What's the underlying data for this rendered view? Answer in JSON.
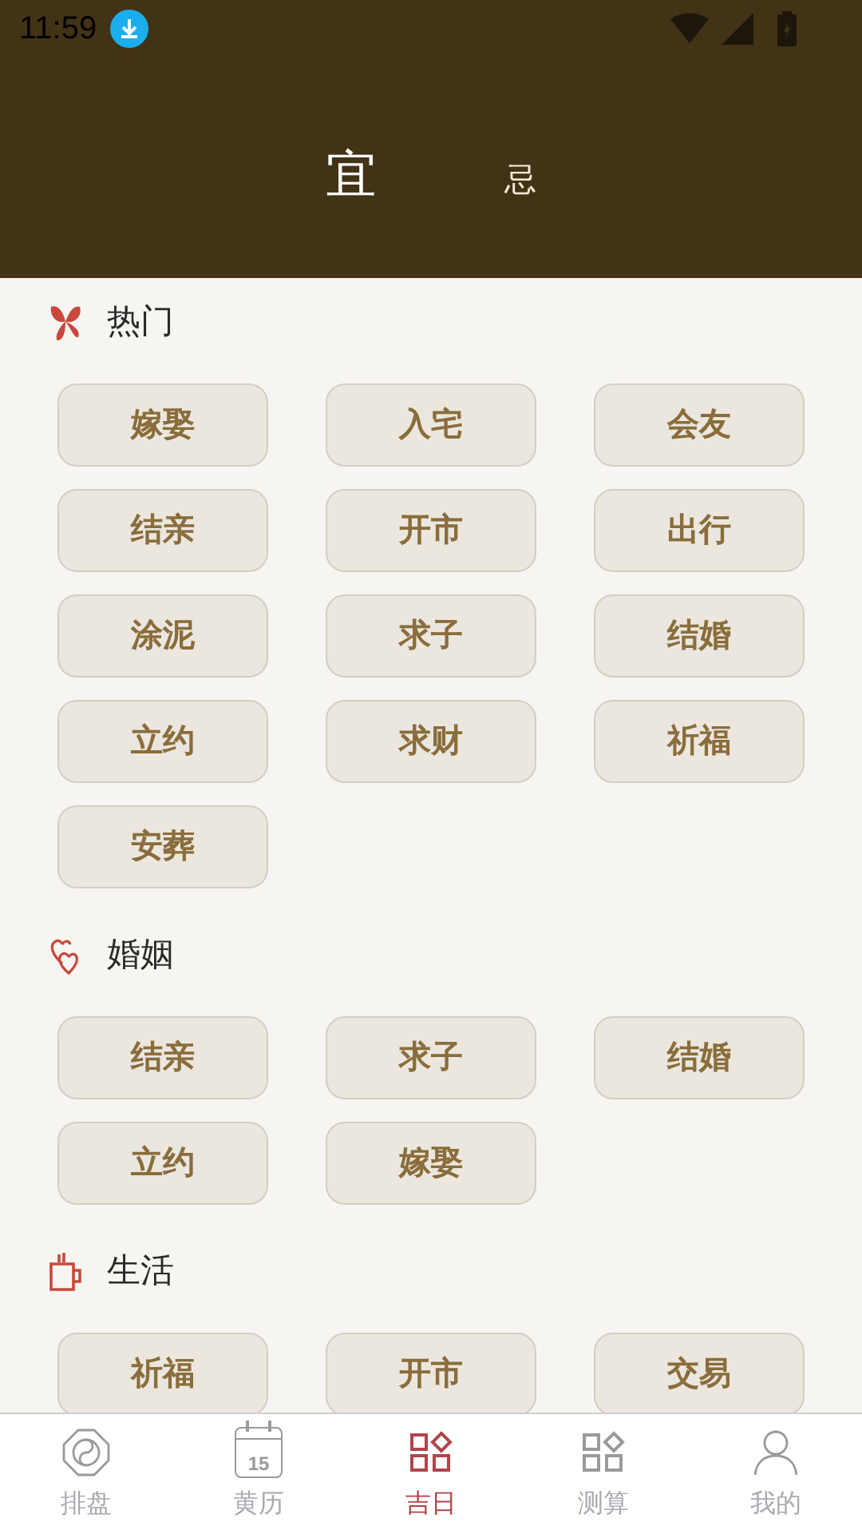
{
  "status_bar": {
    "time": "11:59"
  },
  "tabs": [
    {
      "label": "宜",
      "selected": true
    },
    {
      "label": "忌",
      "selected": false
    }
  ],
  "sections": [
    {
      "title": "热门",
      "kind": "hot",
      "items": [
        "嫁娶",
        "入宅",
        "会友",
        "结亲",
        "开市",
        "出行",
        "涂泥",
        "求子",
        "结婚",
        "立约",
        "求财",
        "祈福",
        "安葬"
      ]
    },
    {
      "title": "婚姻",
      "kind": "marriage",
      "items": [
        "结亲",
        "求子",
        "结婚",
        "立约",
        "嫁娶"
      ]
    },
    {
      "title": "生活",
      "kind": "life",
      "items": [
        "祈福",
        "开市",
        "交易"
      ]
    }
  ],
  "bottom_nav": [
    {
      "label": "排盘",
      "kind": "bagua",
      "selected": false
    },
    {
      "label": "黄历",
      "kind": "calendar",
      "icon_text": "15",
      "selected": false
    },
    {
      "label": "吉日",
      "kind": "grid",
      "selected": true
    },
    {
      "label": "测算",
      "kind": "grid",
      "selected": false
    },
    {
      "label": "我的",
      "kind": "person",
      "selected": false
    }
  ]
}
